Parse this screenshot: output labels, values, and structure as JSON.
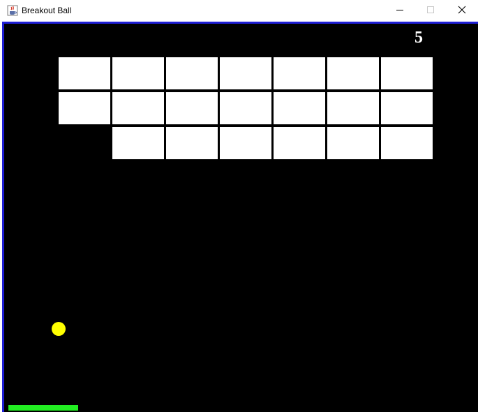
{
  "window": {
    "title": "Breakout Ball",
    "app_icon": "java-cup-icon",
    "controls": [
      "minimize-icon",
      "maximize-icon",
      "close-icon"
    ]
  },
  "game": {
    "score": "5",
    "bricks": {
      "rows": 3,
      "columns": 7,
      "present": [
        [
          1,
          1,
          1,
          1,
          1,
          1,
          1
        ],
        [
          1,
          1,
          1,
          1,
          1,
          1,
          1
        ],
        [
          0,
          1,
          1,
          1,
          1,
          1,
          1
        ]
      ]
    },
    "colors": {
      "background": "#000000",
      "border": "#1f1fd6",
      "brick": "#ffffff",
      "ball": "#ffff00",
      "paddle": "#22ee22",
      "score": "#ffffff"
    }
  }
}
